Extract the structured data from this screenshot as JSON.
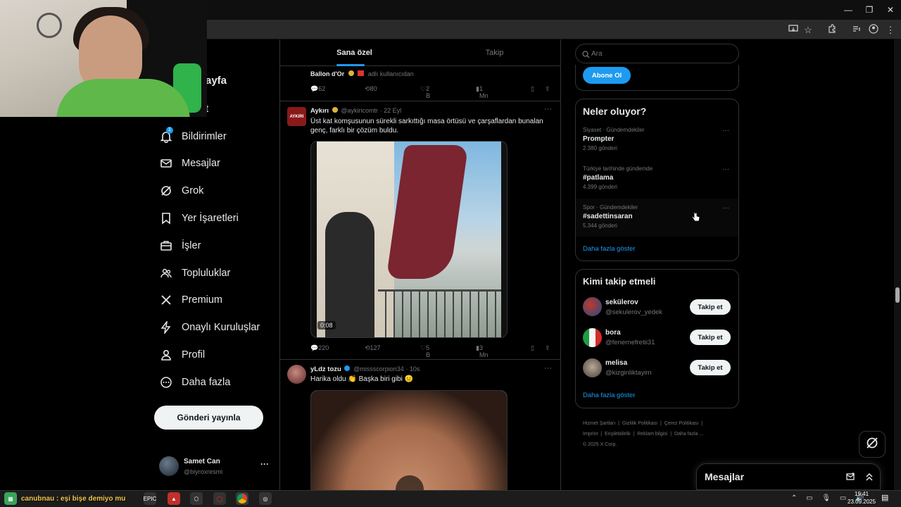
{
  "browser": {
    "window_controls": {
      "minimize": "—",
      "restore": "❐",
      "close": "✕"
    }
  },
  "nav": {
    "home_partial": "ayfa",
    "explore_partial": "t",
    "items": [
      {
        "label": "Bildirimler",
        "icon": "bell-icon",
        "badge": "1"
      },
      {
        "label": "Mesajlar",
        "icon": "mail-icon"
      },
      {
        "label": "Grok",
        "icon": "grok-icon"
      },
      {
        "label": "Yer İşaretleri",
        "icon": "bookmark-icon"
      },
      {
        "label": "İşler",
        "icon": "briefcase-icon"
      },
      {
        "label": "Topluluklar",
        "icon": "people-icon"
      },
      {
        "label": "Premium",
        "icon": "x-logo-icon"
      },
      {
        "label": "Onaylı Kuruluşlar",
        "icon": "lightning-icon"
      },
      {
        "label": "Profil",
        "icon": "person-icon"
      },
      {
        "label": "Daha fazla",
        "icon": "more-circle-icon"
      }
    ],
    "post_button": "Gönderi yayınla",
    "user": {
      "name": "Samet Can",
      "handle": "@biyroxresmi",
      "more": "···"
    }
  },
  "feed": {
    "tabs": [
      {
        "label": "Sana özel",
        "active": true
      },
      {
        "label": "Takip",
        "active": false
      }
    ],
    "partial_tweet": {
      "text": "Ballon d'Or",
      "suffix": "adlı kullanıcıdan",
      "stats": {
        "replies": "62",
        "retweets": "80",
        "likes": "2 B",
        "views": "1 Mn"
      }
    },
    "tweet1": {
      "avatar_text": "AYKIRI",
      "name": "Aykırı",
      "handle": "@aykiricomtr",
      "time": "· 22 Eyl",
      "text_line1": "Üst kat komşusunun sürekli sarkıttığı masa örtüsü ve çarşaflardan bunalan",
      "text_line2": "genç, farklı bir çözüm buldu.",
      "video_duration": "0:08",
      "stats": {
        "replies": "220",
        "retweets": "127",
        "likes": "5 B",
        "views": "3 Mn"
      }
    },
    "tweet2": {
      "name": "yLdz tozu",
      "handle": "@missscorpion34",
      "time": "· 10s",
      "text": "Harika oldu 👏 Başka biri gibi 😐"
    }
  },
  "right": {
    "search_placeholder": "Ara",
    "subscribe_button": "Abone Ol",
    "trends_title": "Neler oluyor?",
    "trends": [
      {
        "context": "Siyaset · Gündemdekiler",
        "name": "Prompter",
        "count": "2.380 gönderi"
      },
      {
        "context": "Türkiye tarihinde gündemde",
        "name": "#patlama",
        "count": "4.399 gönderi"
      },
      {
        "context": "Spor · Gündemdekiler",
        "name": "#sadettinsaran",
        "count": "5.344 gönderi"
      }
    ],
    "trends_more": "Daha fazla göster",
    "follow_title": "Kimi takip etmeli",
    "follow": [
      {
        "name": "sekülerov",
        "handle": "@sekulerov_yedek",
        "button": "Takip et"
      },
      {
        "name": "bora",
        "handle": "@fenernefretii31",
        "button": "Takip et"
      },
      {
        "name": "melisa",
        "handle": "@kizginliktayim",
        "button": "Takip et"
      }
    ],
    "follow_more": "Daha fazla göster",
    "footer": [
      "Hizmet Şartları",
      "Gizlilik Politikası",
      "Çerez Politikası",
      "Imprint",
      "Erişilebilirlik",
      "Reklam bilgisi",
      "Daha fazla ...",
      "© 2025 X Corp."
    ]
  },
  "messages_drawer": {
    "title": "Mesajlar"
  },
  "taskbar": {
    "ticker": "canubnau : eşi bişe demiyo mu",
    "time": "19:41",
    "date": "23.09.2025"
  }
}
